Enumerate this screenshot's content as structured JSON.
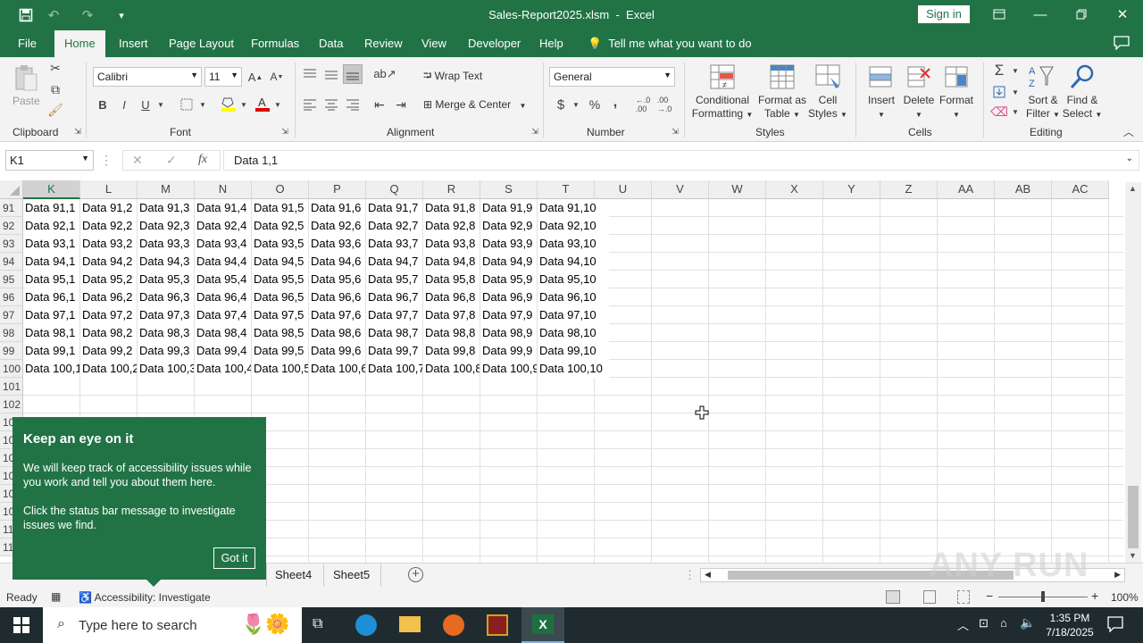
{
  "title": {
    "document": "Sales-Report2025.xlsm",
    "app": "Excel",
    "sign_in": "Sign in"
  },
  "tabs": [
    "File",
    "Home",
    "Insert",
    "Page Layout",
    "Formulas",
    "Data",
    "Review",
    "View",
    "Developer",
    "Help"
  ],
  "tell_me": "Tell me what you want to do",
  "ribbon": {
    "clipboard": {
      "label": "Clipboard",
      "paste": "Paste"
    },
    "font": {
      "label": "Font",
      "name": "Calibri",
      "size": "11",
      "bold": "B",
      "italic": "I",
      "underline": "U"
    },
    "alignment": {
      "label": "Alignment",
      "wrap": "Wrap Text",
      "merge": "Merge & Center"
    },
    "number": {
      "label": "Number",
      "format": "General",
      "currency": "$",
      "percent": "%",
      "comma": ","
    },
    "styles": {
      "label": "Styles",
      "conditional": [
        "Conditional",
        "Formatting"
      ],
      "format_table": [
        "Format as",
        "Table"
      ],
      "cell_styles": [
        "Cell",
        "Styles"
      ]
    },
    "cells": {
      "label": "Cells",
      "insert": "Insert",
      "delete": "Delete",
      "format": "Format"
    },
    "editing": {
      "label": "Editing",
      "sort": [
        "Sort &",
        "Filter"
      ],
      "find": [
        "Find &",
        "Select"
      ]
    }
  },
  "formula_bar": {
    "name_box": "K1",
    "fx": "fx",
    "content": "Data 1,1"
  },
  "columns": [
    "K",
    "L",
    "M",
    "N",
    "O",
    "P",
    "Q",
    "R",
    "S",
    "T",
    "U",
    "V",
    "W",
    "X",
    "Y",
    "Z",
    "AA",
    "AB",
    "AC"
  ],
  "rows": [
    {
      "n": "91",
      "cells": [
        "Data 91,1",
        "Data 91,2",
        "Data 91,3",
        "Data 91,4",
        "Data 91,5",
        "Data 91,6",
        "Data 91,7",
        "Data 91,8",
        "Data 91,9",
        "Data 91,10"
      ]
    },
    {
      "n": "92",
      "cells": [
        "Data 92,1",
        "Data 92,2",
        "Data 92,3",
        "Data 92,4",
        "Data 92,5",
        "Data 92,6",
        "Data 92,7",
        "Data 92,8",
        "Data 92,9",
        "Data 92,10"
      ]
    },
    {
      "n": "93",
      "cells": [
        "Data 93,1",
        "Data 93,2",
        "Data 93,3",
        "Data 93,4",
        "Data 93,5",
        "Data 93,6",
        "Data 93,7",
        "Data 93,8",
        "Data 93,9",
        "Data 93,10"
      ]
    },
    {
      "n": "94",
      "cells": [
        "Data 94,1",
        "Data 94,2",
        "Data 94,3",
        "Data 94,4",
        "Data 94,5",
        "Data 94,6",
        "Data 94,7",
        "Data 94,8",
        "Data 94,9",
        "Data 94,10"
      ]
    },
    {
      "n": "95",
      "cells": [
        "Data 95,1",
        "Data 95,2",
        "Data 95,3",
        "Data 95,4",
        "Data 95,5",
        "Data 95,6",
        "Data 95,7",
        "Data 95,8",
        "Data 95,9",
        "Data 95,10"
      ]
    },
    {
      "n": "96",
      "cells": [
        "Data 96,1",
        "Data 96,2",
        "Data 96,3",
        "Data 96,4",
        "Data 96,5",
        "Data 96,6",
        "Data 96,7",
        "Data 96,8",
        "Data 96,9",
        "Data 96,10"
      ]
    },
    {
      "n": "97",
      "cells": [
        "Data 97,1",
        "Data 97,2",
        "Data 97,3",
        "Data 97,4",
        "Data 97,5",
        "Data 97,6",
        "Data 97,7",
        "Data 97,8",
        "Data 97,9",
        "Data 97,10"
      ]
    },
    {
      "n": "98",
      "cells": [
        "Data 98,1",
        "Data 98,2",
        "Data 98,3",
        "Data 98,4",
        "Data 98,5",
        "Data 98,6",
        "Data 98,7",
        "Data 98,8",
        "Data 98,9",
        "Data 98,10"
      ]
    },
    {
      "n": "99",
      "cells": [
        "Data 99,1",
        "Data 99,2",
        "Data 99,3",
        "Data 99,4",
        "Data 99,5",
        "Data 99,6",
        "Data 99,7",
        "Data 99,8",
        "Data 99,9",
        "Data 99,10"
      ]
    },
    {
      "n": "100",
      "cells": [
        "Data 100,1",
        "Data 100,2",
        "Data 100,3",
        "Data 100,4",
        "Data 100,5",
        "Data 100,6",
        "Data 100,7",
        "Data 100,8",
        "Data 100,9",
        "Data 100,10"
      ]
    },
    {
      "n": "101",
      "cells": []
    },
    {
      "n": "102",
      "cells": []
    },
    {
      "n": "10",
      "cells": []
    },
    {
      "n": "10",
      "cells": []
    },
    {
      "n": "10",
      "cells": []
    },
    {
      "n": "10",
      "cells": []
    },
    {
      "n": "10",
      "cells": []
    },
    {
      "n": "10",
      "cells": []
    },
    {
      "n": "11",
      "cells": []
    },
    {
      "n": "11",
      "cells": []
    }
  ],
  "popup": {
    "title": "Keep an eye on it",
    "p1": "We will keep track of accessibility issues while you work and tell you about them here.",
    "p2": "Click the status bar message to investigate issues we find.",
    "button": "Got it"
  },
  "sheets": [
    "Sheet4",
    "Sheet5"
  ],
  "status": {
    "ready": "Ready",
    "accessibility": "Accessibility: Investigate",
    "zoom": "100%"
  },
  "taskbar": {
    "search": "Type here to search",
    "time": "1:35 PM",
    "date": "7/18/2025"
  },
  "watermark": "ANY RUN",
  "colors": {
    "excel_green": "#217346",
    "taskbar": "#1f2b2f"
  }
}
